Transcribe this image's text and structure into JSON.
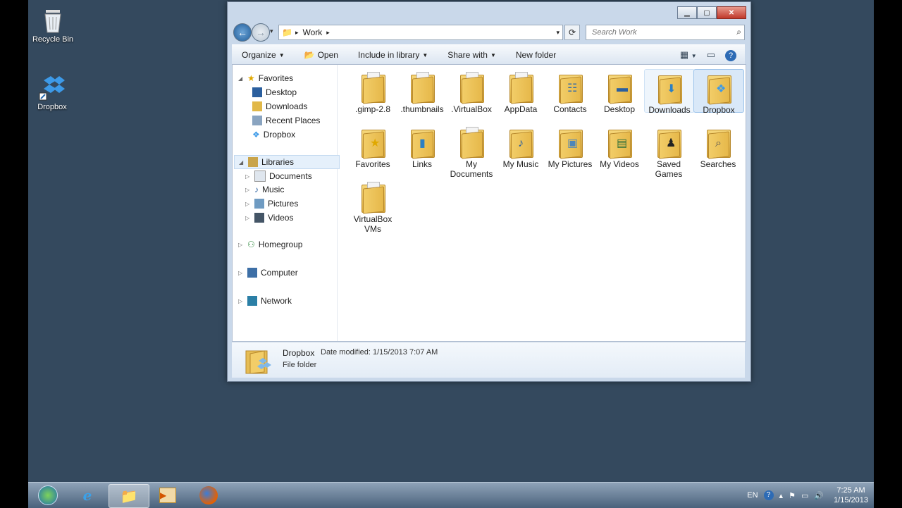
{
  "desktop": {
    "icons": [
      {
        "label": "Recycle Bin",
        "icon": "recycle-bin-icon"
      },
      {
        "label": "Dropbox",
        "icon": "dropbox-icon"
      }
    ]
  },
  "window": {
    "nav": {
      "path_segment": "Work",
      "search_placeholder": "Search Work"
    },
    "toolbar": {
      "organize": "Organize",
      "open": "Open",
      "include_in_library": "Include in library",
      "share_with": "Share with",
      "new_folder": "New folder"
    },
    "nav_pane": {
      "favorites": "Favorites",
      "favorites_items": [
        "Desktop",
        "Downloads",
        "Recent Places",
        "Dropbox"
      ],
      "libraries": "Libraries",
      "libraries_items": [
        "Documents",
        "Music",
        "Pictures",
        "Videos"
      ],
      "homegroup": "Homegroup",
      "computer": "Computer",
      "network": "Network"
    },
    "files": [
      {
        "label": ".gimp-2.8"
      },
      {
        "label": ".thumbnails"
      },
      {
        "label": ".VirtualBox"
      },
      {
        "label": "AppData"
      },
      {
        "label": "Contacts"
      },
      {
        "label": "Desktop"
      },
      {
        "label": "Downloads"
      },
      {
        "label": "Dropbox"
      },
      {
        "label": "Favorites"
      },
      {
        "label": "Links"
      },
      {
        "label": "My Documents"
      },
      {
        "label": "My Music"
      },
      {
        "label": "My Pictures"
      },
      {
        "label": "My Videos"
      },
      {
        "label": "Saved Games"
      },
      {
        "label": "Searches"
      },
      {
        "label": "VirtualBox VMs"
      }
    ],
    "details": {
      "name": "Dropbox",
      "date_modified": "Date modified: 1/15/2013 7:07 AM",
      "type": "File folder"
    }
  },
  "taskbar": {
    "language": "EN",
    "time": "7:25 AM",
    "date": "1/15/2013"
  }
}
